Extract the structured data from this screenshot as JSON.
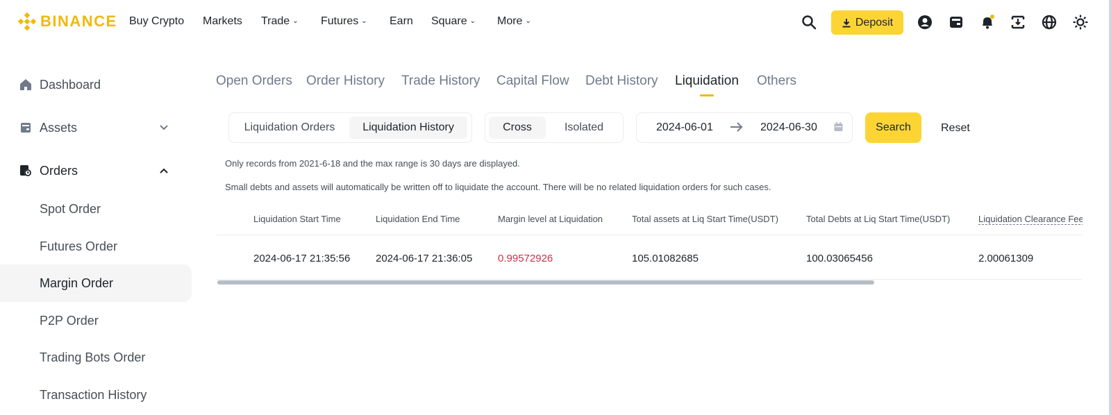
{
  "brand": {
    "name": "BINANCE",
    "color": "#F0B90B"
  },
  "topnav": {
    "items": [
      {
        "label": "Buy Crypto",
        "has_caret": false
      },
      {
        "label": "Markets",
        "has_caret": false
      },
      {
        "label": "Trade",
        "has_caret": true
      },
      {
        "label": "Futures",
        "has_caret": true
      },
      {
        "label": "Earn",
        "has_caret": false
      },
      {
        "label": "Square",
        "has_caret": true
      },
      {
        "label": "More",
        "has_caret": true
      }
    ],
    "deposit_label": "Deposit",
    "icons": [
      "search-icon",
      "user-icon",
      "wallet-icon",
      "bell-icon",
      "download-app-icon",
      "globe-icon",
      "theme-icon"
    ]
  },
  "sidebar": {
    "items": [
      {
        "label": "Dashboard",
        "icon": "home-icon"
      },
      {
        "label": "Assets",
        "icon": "wallet-icon",
        "chevron": "down"
      },
      {
        "label": "Orders",
        "icon": "orders-icon",
        "chevron": "up"
      },
      {
        "label": "Spot Order"
      },
      {
        "label": "Futures Order"
      },
      {
        "label": "Margin Order",
        "active": true
      },
      {
        "label": "P2P Order"
      },
      {
        "label": "Trading Bots Order"
      },
      {
        "label": "Transaction History"
      }
    ]
  },
  "tabs": [
    {
      "label": "Open Orders"
    },
    {
      "label": "Order History"
    },
    {
      "label": "Trade History"
    },
    {
      "label": "Capital Flow"
    },
    {
      "label": "Debt History"
    },
    {
      "label": "Liquidation",
      "active": true
    },
    {
      "label": "Others"
    }
  ],
  "filters": {
    "order_type": {
      "options": [
        "Liquidation Orders",
        "Liquidation History"
      ],
      "selected": "Liquidation History"
    },
    "margin_mode": {
      "options": [
        "Cross",
        "Isolated"
      ],
      "selected": "Cross"
    },
    "date_from": "2024-06-01",
    "date_to": "2024-06-30",
    "search_label": "Search",
    "reset_label": "Reset"
  },
  "notes": {
    "range": "Only records from 2021-6-18 and the max range is 30 days are displayed.",
    "small_debts": "Small debts and assets will automatically be written off to liquidate the account. There will be no related liquidation orders for such cases."
  },
  "table": {
    "headers": [
      "Liquidation Start Time",
      "Liquidation End Time",
      "Margin level at Liquidation",
      "Total assets at Liq Start Time(USDT)",
      "Total Debts at Liq Start Time(USDT)",
      "Liquidation Clearance Fee"
    ],
    "rows": [
      [
        "2024-06-17 21:35:56",
        "2024-06-17 21:36:05",
        "0.99572926",
        "105.01082685",
        "100.03065456",
        "2.00061309"
      ]
    ]
  },
  "colors": {
    "accent": "#FCD535",
    "negative": "#cf304a",
    "muted": "#707a8a"
  }
}
